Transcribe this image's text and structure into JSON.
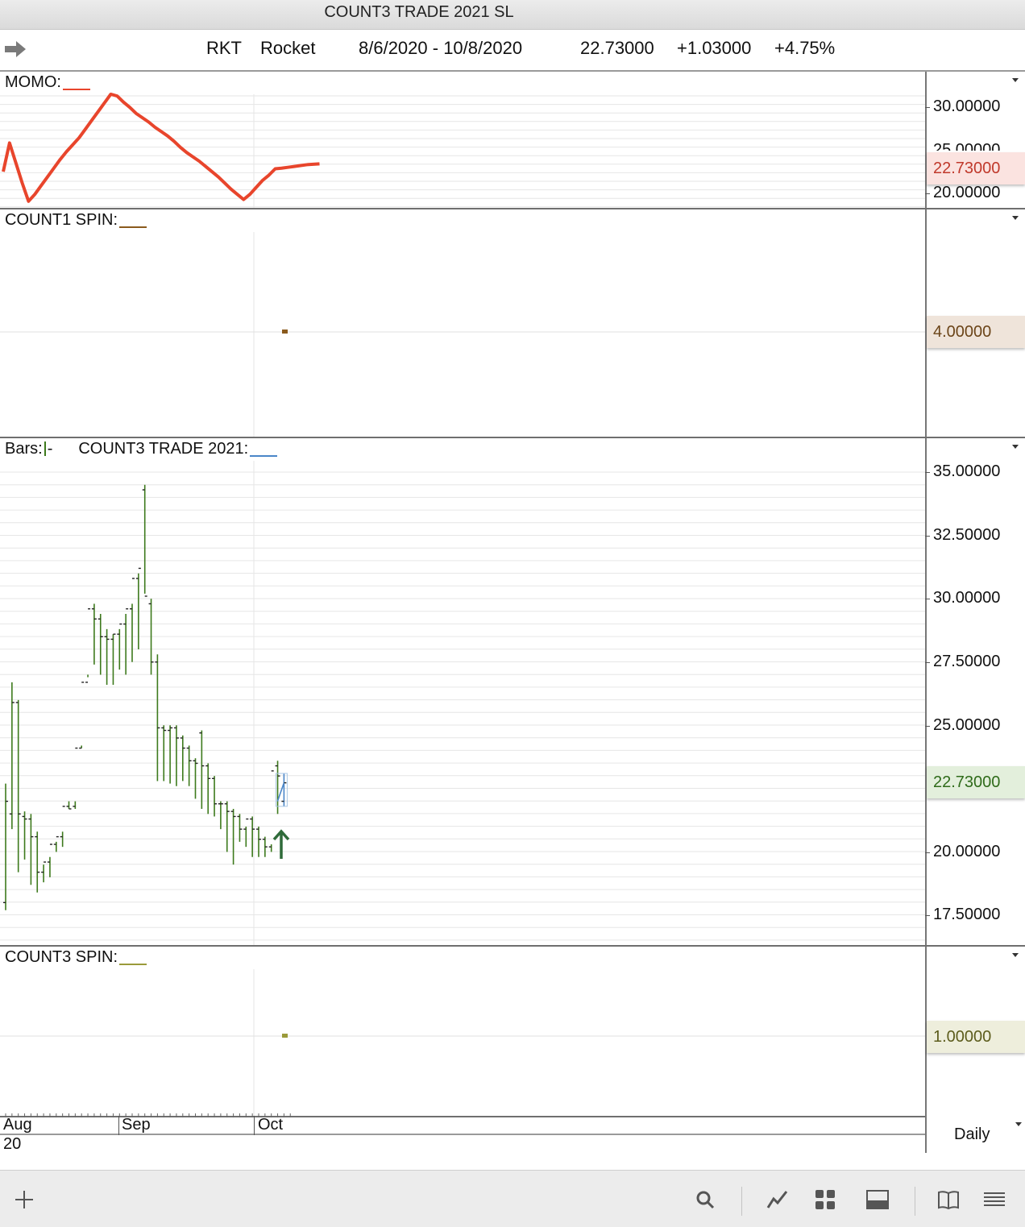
{
  "window": {
    "title": "COUNT3 TRADE 2021 SL"
  },
  "header": {
    "symbol": "RKT",
    "name": "Rocket",
    "date_range": "8/6/2020 - 10/8/2020",
    "last": "22.73000",
    "change": "+1.03000",
    "change_pct": "+4.75%"
  },
  "colors": {
    "momo": "#e8452c",
    "bars": "#3d7a1c",
    "trade": "#4a86c8",
    "count1": "#8a5a1c",
    "count3": "#9a9a3a",
    "arrow_up": "#2f6b3a"
  },
  "panes": {
    "momo": {
      "label": "MOMO:",
      "value": "22.73000",
      "ticks": [
        "30.00000",
        "25.00000",
        "20.00000"
      ]
    },
    "count1": {
      "label": "COUNT1 SPIN:",
      "value": "4.00000"
    },
    "bars": {
      "label": "Bars:",
      "study": "COUNT3 TRADE 2021:",
      "value": "22.73000",
      "ticks": [
        "35.00000",
        "32.50000",
        "30.00000",
        "27.50000",
        "25.00000",
        "20.00000",
        "17.50000"
      ]
    },
    "count3": {
      "label": "COUNT3 SPIN:",
      "value": "1.00000"
    }
  },
  "dates": {
    "aug": "Aug",
    "year": "20",
    "sep": "Sep",
    "oct": "Oct"
  },
  "period": "Daily",
  "chart_data": [
    {
      "type": "line",
      "name": "MOMO",
      "ylim": [
        18.5,
        32.5
      ],
      "x": [
        0,
        1,
        2,
        3,
        4,
        5,
        6,
        7,
        8,
        9,
        10,
        11,
        12,
        13,
        14,
        15,
        16,
        17,
        18,
        19,
        20,
        21,
        22,
        23,
        24,
        25,
        26,
        27,
        28,
        29,
        30,
        31,
        32,
        33,
        34,
        35,
        36,
        37,
        38,
        39,
        40,
        41,
        42,
        43,
        44,
        45,
        46,
        47,
        48,
        49,
        50
      ],
      "values": [
        22.4,
        25.7,
        23.4,
        21.1,
        19.0,
        19.8,
        20.8,
        21.8,
        22.8,
        23.8,
        24.7,
        25.5,
        26.3,
        27.3,
        28.3,
        29.3,
        30.3,
        31.3,
        31.1,
        30.4,
        29.8,
        29.1,
        28.6,
        28.1,
        27.5,
        27.0,
        26.5,
        25.9,
        25.2,
        24.6,
        24.1,
        23.6,
        23.0,
        22.4,
        21.8,
        21.1,
        20.4,
        19.8,
        19.2,
        19.8,
        20.6,
        21.4,
        22.0,
        22.73,
        22.8,
        22.9,
        23.0,
        23.1,
        23.2,
        23.25,
        23.3
      ]
    },
    {
      "type": "scatter",
      "name": "COUNT1 SPIN",
      "ylim": [
        0,
        8
      ],
      "x": [
        44
      ],
      "values": [
        4.0
      ]
    },
    {
      "type": "ohlc",
      "name": "Bars",
      "ylim": [
        16.9,
        36.4
      ],
      "x": [
        0,
        1,
        2,
        3,
        4,
        5,
        6,
        7,
        8,
        9,
        10,
        11,
        12,
        13,
        14,
        15,
        16,
        17,
        18,
        19,
        20,
        21,
        22,
        23,
        24,
        25,
        26,
        27,
        28,
        29,
        30,
        31,
        32,
        33,
        34,
        35,
        36,
        37,
        38,
        39,
        40,
        41,
        42,
        43,
        44
      ],
      "high": [
        22.7,
        26.7,
        26.0,
        21.6,
        21.5,
        20.8,
        19.5,
        19.8,
        20.4,
        20.8,
        21.7,
        21.7,
        24.1,
        26.9,
        29.8,
        29.4,
        28.8,
        28.6,
        28.8,
        29.4,
        29.8,
        31.0,
        34.5,
        30.0,
        27.8,
        25.0,
        25.0,
        25.0,
        24.6,
        24.2,
        23.7,
        24.8,
        23.5,
        23.0,
        22.0,
        22.0,
        21.7,
        21.5,
        21.0,
        21.4,
        21.0,
        20.6,
        20.3,
        23.6,
        23.1
      ],
      "low": [
        17.7,
        20.9,
        19.2,
        19.7,
        18.7,
        18.4,
        18.8,
        19.0,
        20.0,
        20.2,
        22.0,
        22.0,
        24.2,
        27.0,
        27.4,
        27.0,
        26.6,
        26.6,
        27.2,
        27.0,
        27.5,
        28.0,
        30.2,
        27.0,
        22.8,
        22.8,
        22.7,
        22.6,
        22.8,
        22.6,
        22.1,
        21.7,
        21.5,
        21.4,
        20.9,
        20.0,
        19.5,
        20.4,
        20.2,
        19.8,
        19.8,
        19.8,
        20.0,
        21.5,
        21.8
      ],
      "open": [
        18.0,
        21.5,
        25.9,
        21.4,
        21.3,
        20.6,
        19.2,
        19.6,
        20.3,
        20.6,
        21.8,
        21.8,
        24.1,
        26.7,
        29.6,
        29.2,
        28.5,
        28.4,
        28.6,
        29.0,
        29.6,
        30.8,
        34.3,
        29.8,
        27.5,
        24.9,
        24.8,
        24.9,
        24.5,
        24.1,
        23.6,
        24.7,
        23.4,
        22.9,
        21.9,
        21.9,
        21.6,
        21.4,
        20.9,
        21.3,
        20.9,
        20.5,
        20.2,
        23.4,
        22.0
      ],
      "close": [
        22.0,
        25.9,
        21.5,
        21.3,
        20.6,
        19.2,
        19.6,
        20.3,
        20.6,
        21.8,
        21.7,
        24.1,
        26.7,
        29.6,
        29.2,
        28.5,
        28.4,
        28.6,
        29.0,
        29.6,
        30.8,
        31.2,
        30.1,
        27.5,
        24.9,
        24.8,
        24.9,
        24.5,
        24.1,
        23.6,
        23.5,
        23.4,
        22.9,
        21.9,
        21.9,
        21.6,
        21.4,
        20.9,
        21.3,
        20.9,
        20.5,
        20.2,
        23.2,
        23.0,
        22.73
      ]
    },
    {
      "type": "scatter",
      "name": "COUNT3 SPIN",
      "ylim": [
        0,
        2
      ],
      "x": [
        44
      ],
      "values": [
        1.0
      ]
    }
  ]
}
